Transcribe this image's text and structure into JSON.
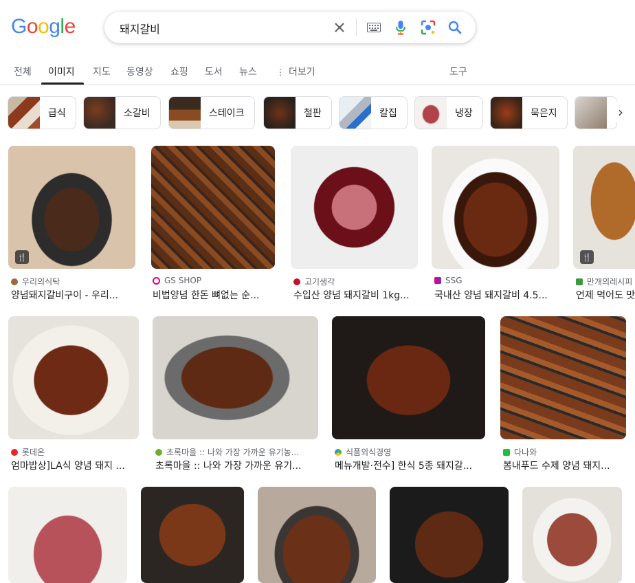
{
  "logo": {
    "letters": [
      "G",
      "o",
      "o",
      "g",
      "l",
      "e"
    ],
    "colors": [
      "#4285F4",
      "#EA4335",
      "#FBBC05",
      "#4285F4",
      "#34A853",
      "#EA4335"
    ]
  },
  "search": {
    "query": "돼지갈비"
  },
  "tabs": [
    {
      "label": "전체"
    },
    {
      "label": "이미지",
      "active": true
    },
    {
      "label": "지도"
    },
    {
      "label": "동영상"
    },
    {
      "label": "쇼핑"
    },
    {
      "label": "도서"
    },
    {
      "label": "뉴스"
    },
    {
      "label": "더보기"
    }
  ],
  "tools_label": "도구",
  "chips": [
    {
      "label": "급식"
    },
    {
      "label": "소갈비"
    },
    {
      "label": "스테이크"
    },
    {
      "label": "철판"
    },
    {
      "label": "칼집"
    },
    {
      "label": "냉장"
    },
    {
      "label": "묵은지"
    }
  ],
  "results": [
    {
      "source": "우리의식탁",
      "title": "양념돼지갈비구이 - 우리..."
    },
    {
      "source": "GS SHOP",
      "title": "비법양념 한돈 뼈없는 순..."
    },
    {
      "source": "고기생각",
      "title": "수입산 양념 돼지갈비 1kg..."
    },
    {
      "source": "SSG",
      "title": "국내산 양념 돼지갈비 4.5..."
    },
    {
      "source": "만개의레시피",
      "title": "언제 먹어도 맛있는"
    },
    {
      "source": "롯데온",
      "title": "엄마밥상]LA식 양념 돼지 ..."
    },
    {
      "source": "초록마을 :: 나와 가장 가까운 유기농...",
      "title": "초록마을 :: 나와 가장 가까운 유기..."
    },
    {
      "source": "식품외식경영",
      "title": "메뉴개발·전수] 한식 5종 돼지갈..."
    },
    {
      "source": "다나와",
      "title": "봄내푸드 수제 양념 돼지..."
    }
  ]
}
